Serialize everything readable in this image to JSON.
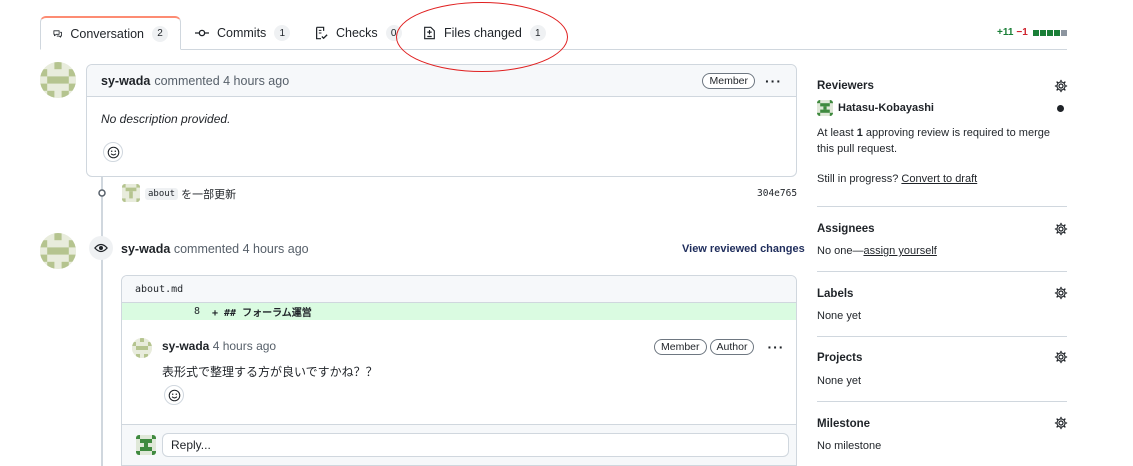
{
  "tabs": [
    {
      "label": "Conversation",
      "count": "2"
    },
    {
      "label": "Commits",
      "count": "1"
    },
    {
      "label": "Checks",
      "count": "0"
    },
    {
      "label": "Files changed",
      "count": "1"
    }
  ],
  "diffstat": {
    "additions": "+11",
    "deletions": "−1",
    "blocks": [
      "#1a7f37",
      "#1a7f37",
      "#1a7f37",
      "#1a7f37",
      "#8c959f"
    ]
  },
  "first_comment": {
    "author": "sy-wada",
    "meta": "commented 4 hours ago",
    "badge": "Member",
    "body": "No description provided."
  },
  "commit": {
    "code": "about",
    "message": "を一部更新",
    "sha": "304e765"
  },
  "review": {
    "author": "sy-wada",
    "meta": "commented 4 hours ago",
    "view_link": "View reviewed changes",
    "file": "about.md",
    "line_number": "8",
    "line_content": "+ ## フォーラム運営",
    "reply_author": "sy-wada",
    "reply_meta": "4 hours ago",
    "reply_badges": [
      "Member",
      "Author"
    ],
    "reply_body": "表形式で整理する方が良いですかね？？",
    "reply_placeholder": "Reply..."
  },
  "sidebar": {
    "reviewers": {
      "title": "Reviewers",
      "name": "Hatasu-Kobayashi",
      "note_pre": "At least ",
      "note_bold": "1",
      "note_post": " approving review is required to merge this pull request.",
      "progress_text": "Still in progress?",
      "progress_link": "Convert to draft"
    },
    "assignees": {
      "title": "Assignees",
      "none": "No one—",
      "link": "assign yourself"
    },
    "labels": {
      "title": "Labels",
      "value": "None yet"
    },
    "projects": {
      "title": "Projects",
      "value": "None yet"
    },
    "milestone": {
      "title": "Milestone",
      "value": "No milestone"
    }
  },
  "icons": {
    "conversation": "comment-discussion-icon",
    "commits": "git-commit-icon",
    "checks": "checklist-icon",
    "files": "file-diff-icon",
    "gear": "gear-icon",
    "eye": "eye-icon",
    "smiley": "smiley-icon"
  }
}
